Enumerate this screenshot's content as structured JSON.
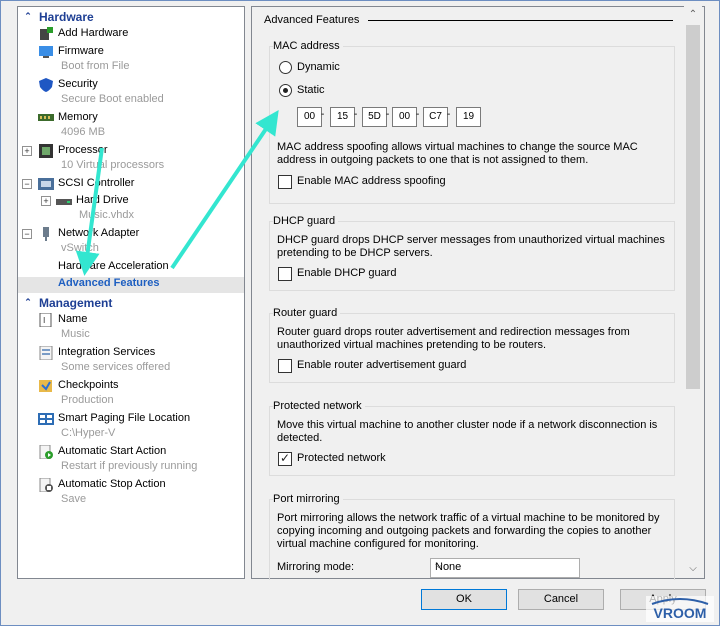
{
  "tree": {
    "hardware_label": "Hardware",
    "management_label": "Management",
    "items": [
      {
        "title": "Add Hardware",
        "sub": ""
      },
      {
        "title": "Firmware",
        "sub": "Boot from File"
      },
      {
        "title": "Security",
        "sub": "Secure Boot enabled"
      },
      {
        "title": "Memory",
        "sub": "4096 MB"
      },
      {
        "title": "Processor",
        "sub": "10 Virtual processors"
      },
      {
        "title": "SCSI Controller",
        "sub": ""
      },
      {
        "title": "Hard Drive",
        "sub": "Music.vhdx"
      },
      {
        "title": "Network Adapter",
        "sub": "vSwitch"
      },
      {
        "title": "Hardware Acceleration",
        "sub": ""
      },
      {
        "title": "Advanced Features",
        "sub": ""
      }
    ],
    "mgmt_items": [
      {
        "title": "Name",
        "sub": "Music"
      },
      {
        "title": "Integration Services",
        "sub": "Some services offered"
      },
      {
        "title": "Checkpoints",
        "sub": "Production"
      },
      {
        "title": "Smart Paging File Location",
        "sub": "C:\\Hyper-V"
      },
      {
        "title": "Automatic Start Action",
        "sub": "Restart if previously running"
      },
      {
        "title": "Automatic Stop Action",
        "sub": "Save"
      }
    ]
  },
  "panel": {
    "title": "Advanced Features",
    "mac": {
      "group": "MAC address",
      "dynamic": "Dynamic",
      "static": "Static",
      "octets": [
        "00",
        "15",
        "5D",
        "00",
        "C7",
        "19"
      ],
      "spoof_desc": "MAC address spoofing allows virtual machines to change the source MAC address in outgoing packets to one that is not assigned to them.",
      "spoof_cb": "Enable MAC address spoofing"
    },
    "dhcp": {
      "group": "DHCP guard",
      "desc": "DHCP guard drops DHCP server messages from unauthorized virtual machines pretending to be DHCP servers.",
      "cb": "Enable DHCP guard"
    },
    "router": {
      "group": "Router guard",
      "desc": "Router guard drops router advertisement and redirection messages from unauthorized virtual machines pretending to be routers.",
      "cb": "Enable router advertisement guard"
    },
    "protected": {
      "group": "Protected network",
      "desc": "Move this virtual machine to another cluster node if a network disconnection is detected.",
      "cb": "Protected network"
    },
    "mirror": {
      "group": "Port mirroring",
      "desc": "Port mirroring allows the network traffic of a virtual machine to be monitored by copying incoming and outgoing packets and forwarding the copies to another virtual machine configured for monitoring.",
      "mode_label": "Mirroring mode:",
      "mode_value": "None"
    }
  },
  "buttons": {
    "ok": "OK",
    "cancel": "Cancel",
    "apply": "Apply"
  },
  "logo_text": "VROOM",
  "colors": {
    "accent": "#1e3f94",
    "selected": "#1e5fc1",
    "annotation_arrow": "#33e6d0"
  }
}
